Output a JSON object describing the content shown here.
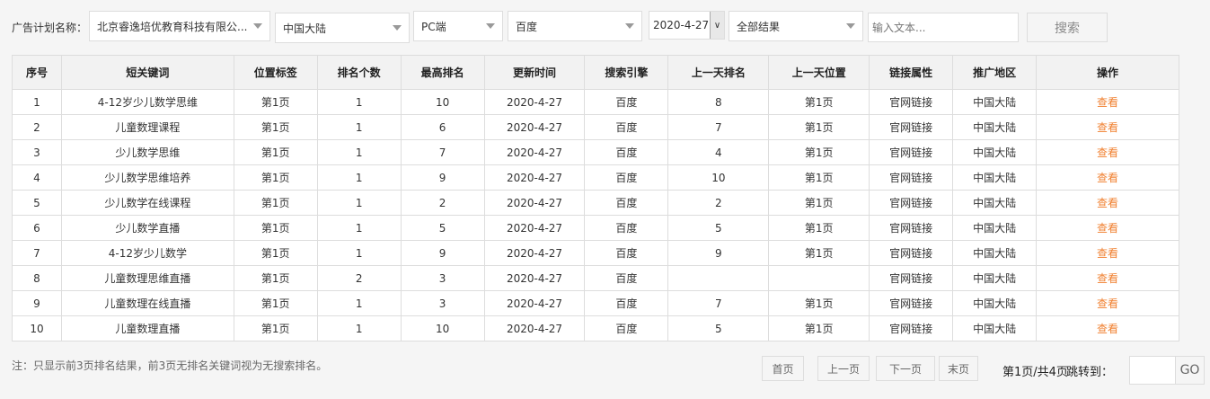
{
  "toolbar": {
    "plan_label": "广告计划名称：",
    "plan": "北京睿逸培优教育科技有限公...",
    "region": "中国大陆",
    "device": "PC端",
    "engine": "百度",
    "date": "2020-4-27",
    "result": "全部结果",
    "search_placeholder": "输入文本...",
    "search_button": "搜索"
  },
  "table": {
    "headers": [
      "序号",
      "短关键词",
      "位置标签",
      "排名个数",
      "最高排名",
      "更新时间",
      "搜索引擎",
      "上一天排名",
      "上一天位置",
      "链接属性",
      "推广地区",
      "操作"
    ],
    "rows": [
      [
        "1",
        "4-12岁少儿数学思维",
        "第1页",
        "1",
        "10",
        "2020-4-27",
        "百度",
        "8",
        "第1页",
        "官网链接",
        "中国大陆",
        "查看"
      ],
      [
        "2",
        "儿童数理课程",
        "第1页",
        "1",
        "6",
        "2020-4-27",
        "百度",
        "7",
        "第1页",
        "官网链接",
        "中国大陆",
        "查看"
      ],
      [
        "3",
        "少儿数学思维",
        "第1页",
        "1",
        "7",
        "2020-4-27",
        "百度",
        "4",
        "第1页",
        "官网链接",
        "中国大陆",
        "查看"
      ],
      [
        "4",
        "少儿数学思维培养",
        "第1页",
        "1",
        "9",
        "2020-4-27",
        "百度",
        "10",
        "第1页",
        "官网链接",
        "中国大陆",
        "查看"
      ],
      [
        "5",
        "少儿数学在线课程",
        "第1页",
        "1",
        "2",
        "2020-4-27",
        "百度",
        "2",
        "第1页",
        "官网链接",
        "中国大陆",
        "查看"
      ],
      [
        "6",
        "少儿数学直播",
        "第1页",
        "1",
        "5",
        "2020-4-27",
        "百度",
        "5",
        "第1页",
        "官网链接",
        "中国大陆",
        "查看"
      ],
      [
        "7",
        "4-12岁少儿数学",
        "第1页",
        "1",
        "9",
        "2020-4-27",
        "百度",
        "9",
        "第1页",
        "官网链接",
        "中国大陆",
        "查看"
      ],
      [
        "8",
        "儿童数理思维直播",
        "第1页",
        "2",
        "3",
        "2020-4-27",
        "百度",
        "",
        "",
        "官网链接",
        "中国大陆",
        "查看"
      ],
      [
        "9",
        "儿童数理在线直播",
        "第1页",
        "1",
        "3",
        "2020-4-27",
        "百度",
        "7",
        "第1页",
        "官网链接",
        "中国大陆",
        "查看"
      ],
      [
        "10",
        "儿童数理直播",
        "第1页",
        "1",
        "10",
        "2020-4-27",
        "百度",
        "5",
        "第1页",
        "官网链接",
        "中国大陆",
        "查看"
      ]
    ]
  },
  "footer": {
    "note": "注：只显示前3页排名结果，前3页无排名关键词视为无搜索排名。",
    "first": "首页",
    "prev": "上一页",
    "next": "下一页",
    "last": "末页",
    "page_info": "第1页/共4页",
    "jump_label": "跳转到：",
    "jump_value": "",
    "go": "GO"
  },
  "colors": {
    "link": "#f08030"
  }
}
